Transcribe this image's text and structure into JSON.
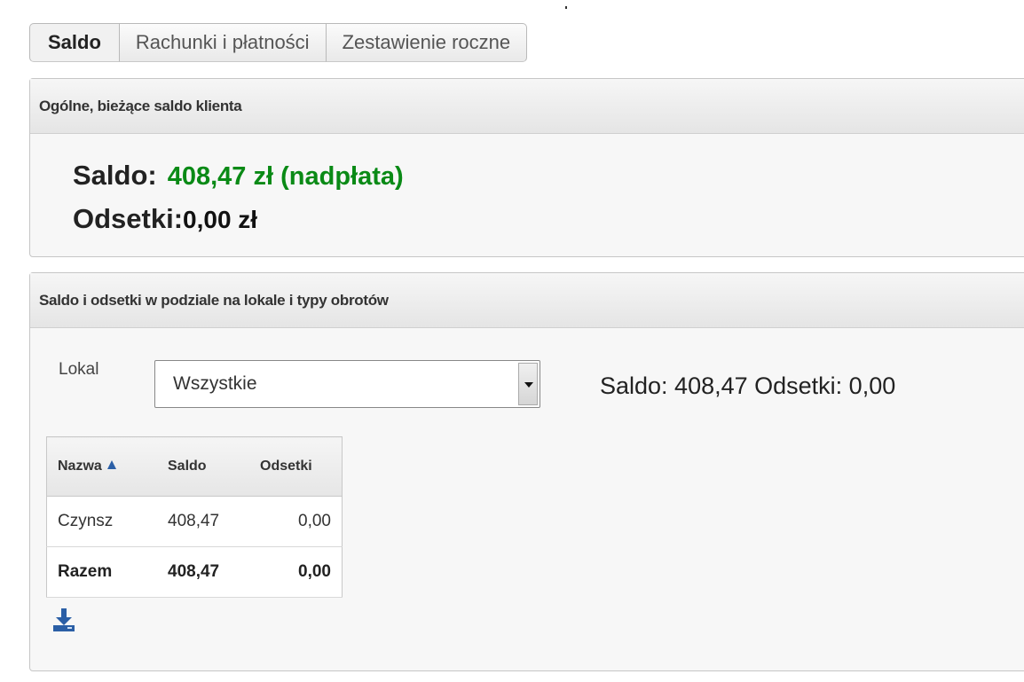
{
  "tabs": [
    "Saldo",
    "Rachunki i płatności",
    "Zestawienie roczne"
  ],
  "panel_general": {
    "title": "Ogólne, bieżące saldo klienta",
    "saldo_label": "Saldo:",
    "saldo_value": "408,47 zł (nadpłata)",
    "odsetki_label": "Odsetki:",
    "odsetki_value": "0,00 zł",
    "saldo_color": "#0a8a16"
  },
  "panel_detail": {
    "title": "Saldo i odsetki w podziale na lokale i typy obrotów",
    "lokal_label": "Lokal",
    "lokal_selected": "Wszystkie",
    "summary": "Saldo: 408,47 Odsetki: 0,00"
  },
  "table": {
    "headers": [
      "Nazwa",
      "Saldo",
      "Odsetki"
    ],
    "rows": [
      [
        "Czynsz",
        "408,47",
        "0,00"
      ]
    ],
    "total": [
      "Razem",
      "408,47",
      "0,00"
    ]
  },
  "icons": {
    "download": "download-icon",
    "sort": "sort-asc-icon"
  }
}
